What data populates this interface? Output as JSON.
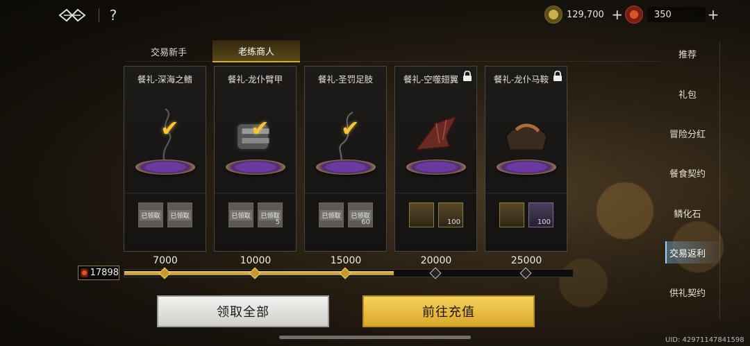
{
  "topbar": {
    "help_label": "?",
    "gold_value": "129,700",
    "gem_value": "350",
    "plus_label": "+"
  },
  "tabs": [
    {
      "label": "交易新手",
      "active": false
    },
    {
      "label": "老练商人",
      "active": true
    }
  ],
  "cards": [
    {
      "title": "餐礼-深海之鳍",
      "locked": false,
      "claimed": true,
      "rewards": [
        {
          "text": "已领取",
          "qty": ""
        },
        {
          "text": "已领取",
          "qty": ""
        }
      ]
    },
    {
      "title": "餐礼-龙仆臂甲",
      "locked": false,
      "claimed": true,
      "rewards": [
        {
          "text": "已领取",
          "qty": ""
        },
        {
          "text": "已领取",
          "qty": "5"
        }
      ]
    },
    {
      "title": "餐礼-圣罚足肢",
      "locked": false,
      "claimed": true,
      "rewards": [
        {
          "text": "已领取",
          "qty": ""
        },
        {
          "text": "已领取",
          "qty": "60"
        }
      ]
    },
    {
      "title": "餐礼-空噬翅翼",
      "locked": true,
      "claimed": false,
      "rewards": [
        {
          "text": "",
          "qty": ""
        },
        {
          "text": "",
          "qty": "100"
        }
      ]
    },
    {
      "title": "餐礼-龙仆马鞍",
      "locked": true,
      "claimed": false,
      "rewards": [
        {
          "text": "",
          "qty": ""
        },
        {
          "text": "",
          "qty": "100"
        }
      ]
    }
  ],
  "milestones": [
    "7000",
    "10000",
    "15000",
    "20000",
    "25000"
  ],
  "progress": {
    "current": "17898",
    "fraction": 0.6
  },
  "buttons": {
    "claim_all": "领取全部",
    "go_recharge": "前往充值"
  },
  "sidemenu": [
    {
      "label": "推荐",
      "active": false
    },
    {
      "label": "礼包",
      "active": false
    },
    {
      "label": "冒险分红",
      "active": false
    },
    {
      "label": "餐食契约",
      "active": false
    },
    {
      "label": "鳞化石",
      "active": false
    },
    {
      "label": "交易返利",
      "active": true
    },
    {
      "label": "供礼契约",
      "active": false
    }
  ],
  "uid": "UID: 42971147841598",
  "colors": {
    "accent_gold": "#d6a72c",
    "claim_button": "#e8e8e4",
    "recharge_button": "#f0c644"
  }
}
